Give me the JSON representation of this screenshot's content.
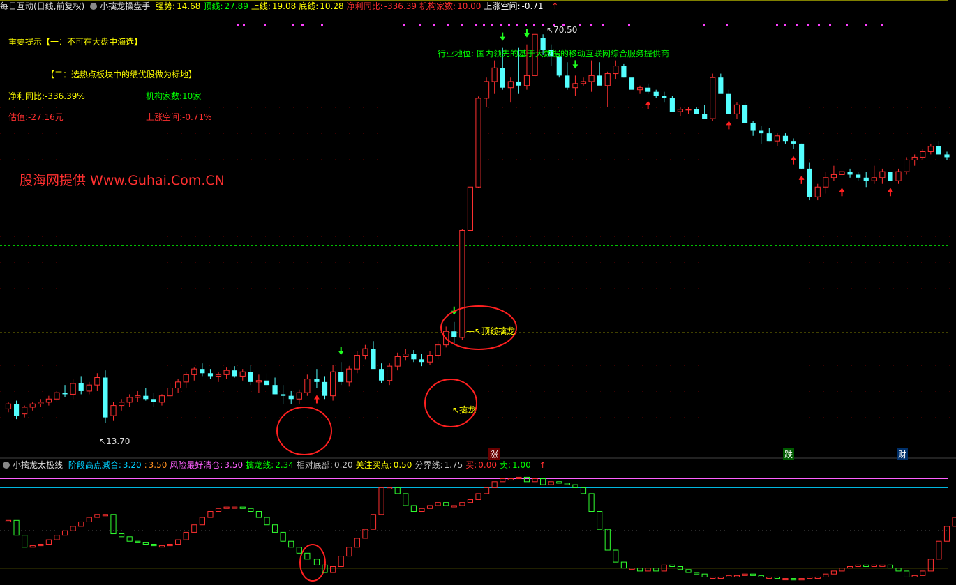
{
  "header": {
    "stock": "每日互动(日线,前复权)",
    "indicator": "小擒龙操盘手",
    "items": [
      {
        "label": "强势:",
        "value": "14.68",
        "lc": "#ffff00",
        "vc": "#ffff00"
      },
      {
        "label": "顶线:",
        "value": "27.89",
        "lc": "#00ff00",
        "vc": "#00ff00"
      },
      {
        "label": "上线:",
        "value": "19.08",
        "lc": "#ffff00",
        "vc": "#ffff00"
      },
      {
        "label": "底线:",
        "value": "10.28",
        "lc": "#ffff00",
        "vc": "#ffff00"
      },
      {
        "label": "净利同比:",
        "value": "-336.39",
        "lc": "#ff3030",
        "vc": "#ff3030"
      },
      {
        "label": "机构家数:",
        "value": "10.00",
        "lc": "#ff3030",
        "vc": "#ff3030"
      },
      {
        "label": "上涨空间:",
        "value": "-0.71",
        "lc": "#ffffff",
        "vc": "#ffffff"
      }
    ]
  },
  "notes": {
    "tip1": "重要提示【一：不可在大盘中海选】",
    "tip2": "【二：选热点板块中的绩优股做为标地】",
    "profit": "净利同比:-336.39%",
    "inst": "机构家数:10家",
    "val": "估值:-27.16元",
    "space": "上涨空间:-0.71%",
    "industry": "行业地位: 国内领先的基于大数据的移动互联网综合服务提供商",
    "watermark": "股海网提供 Www.Guhai.Com.CN",
    "high_label": "70.50",
    "low_label": "13.70",
    "top_dragon": "顶线擒龙",
    "dragon": "擒龙",
    "m_zhang": "涨",
    "m_die": "跌",
    "m_cai": "财"
  },
  "indicator": {
    "title": "小擒龙太极线",
    "items": [
      {
        "label": "阶段高点减合:",
        "value": "3.20",
        "c": "#00d0ff"
      },
      {
        "label": ":",
        "value": "3.50",
        "c": "#ff9020"
      },
      {
        "label": "风险最好清仓:",
        "value": "3.50",
        "c": "#ff60ff"
      },
      {
        "label": "擒龙线:",
        "value": "2.34",
        "c": "#00ff00"
      },
      {
        "label": "相对底部:",
        "value": "0.20",
        "c": "#c0c0c0"
      },
      {
        "label": "关注买点:",
        "value": "0.50",
        "c": "#ffff00"
      },
      {
        "label": "分界线:",
        "value": "1.75",
        "c": "#c0c0c0"
      },
      {
        "label": "买:",
        "value": "0.00",
        "c": "#ff3030"
      },
      {
        "label": "卖:",
        "value": "1.00",
        "c": "#00ff00"
      }
    ]
  },
  "colors": {
    "up": "#ff3030",
    "down": "#54ffff",
    "bg": "#000000",
    "topline": "#00ff00",
    "midline": "#ffff00",
    "bottomline": "#ffff00"
  },
  "chart_data": {
    "type": "candlestick",
    "price": [
      [
        13.7,
        14.1,
        13.5,
        14.0
      ],
      [
        14.0,
        14.2,
        13.1,
        13.3
      ],
      [
        13.4,
        13.9,
        13.2,
        13.8
      ],
      [
        13.8,
        14.1,
        13.6,
        14.0
      ],
      [
        14.0,
        14.3,
        13.8,
        14.1
      ],
      [
        14.1,
        14.5,
        13.9,
        14.3
      ],
      [
        14.3,
        14.8,
        14.1,
        14.7
      ],
      [
        14.7,
        15.2,
        14.4,
        14.6
      ],
      [
        14.6,
        15.6,
        14.3,
        15.3
      ],
      [
        15.3,
        15.8,
        14.6,
        14.8
      ],
      [
        14.8,
        15.4,
        14.6,
        15.2
      ],
      [
        15.2,
        16.0,
        14.8,
        15.7
      ],
      [
        15.7,
        16.2,
        12.9,
        13.2
      ],
      [
        13.3,
        14.1,
        13.0,
        13.9
      ],
      [
        13.9,
        14.3,
        13.6,
        14.1
      ],
      [
        14.1,
        14.6,
        13.8,
        14.4
      ],
      [
        14.4,
        14.8,
        14.1,
        14.5
      ],
      [
        14.5,
        15.0,
        14.2,
        14.3
      ],
      [
        14.3,
        14.7,
        13.8,
        14.1
      ],
      [
        14.1,
        14.6,
        13.9,
        14.5
      ],
      [
        14.5,
        15.3,
        14.3,
        15.0
      ],
      [
        15.0,
        15.6,
        14.7,
        15.4
      ],
      [
        15.4,
        16.1,
        15.0,
        15.9
      ],
      [
        15.9,
        16.4,
        15.5,
        16.3
      ],
      [
        16.3,
        16.7,
        15.8,
        16.0
      ],
      [
        16.0,
        16.3,
        15.6,
        15.8
      ],
      [
        15.8,
        16.1,
        15.4,
        15.9
      ],
      [
        15.9,
        16.4,
        15.6,
        16.2
      ],
      [
        16.2,
        16.5,
        15.7,
        15.8
      ],
      [
        15.8,
        16.3,
        15.5,
        16.1
      ],
      [
        16.1,
        16.6,
        15.2,
        15.4
      ],
      [
        15.4,
        15.9,
        14.7,
        15.5
      ],
      [
        15.5,
        16.0,
        15.0,
        15.2
      ],
      [
        15.2,
        15.7,
        14.6,
        14.6
      ],
      [
        14.6,
        15.2,
        14.0,
        14.5
      ],
      [
        14.5,
        14.8,
        14.0,
        14.3
      ],
      [
        14.3,
        14.9,
        14.0,
        14.7
      ],
      [
        14.7,
        15.9,
        14.5,
        15.6
      ],
      [
        15.6,
        16.3,
        15.0,
        15.4
      ],
      [
        15.4,
        15.8,
        14.3,
        14.5
      ],
      [
        14.5,
        16.6,
        14.2,
        16.1
      ],
      [
        16.1,
        16.8,
        15.2,
        15.4
      ],
      [
        15.4,
        16.5,
        15.1,
        16.3
      ],
      [
        16.3,
        17.6,
        16.0,
        17.3
      ],
      [
        17.3,
        18.1,
        17.0,
        17.8
      ],
      [
        17.8,
        18.4,
        16.9,
        16.3
      ],
      [
        16.3,
        16.7,
        15.3,
        15.5
      ],
      [
        15.5,
        16.7,
        15.2,
        16.5
      ],
      [
        16.5,
        17.5,
        16.2,
        17.2
      ],
      [
        17.2,
        17.8,
        16.9,
        17.4
      ],
      [
        17.4,
        17.7,
        16.8,
        17.0
      ],
      [
        17.0,
        17.4,
        16.5,
        16.8
      ],
      [
        16.8,
        17.6,
        16.6,
        17.3
      ],
      [
        17.3,
        18.4,
        17.0,
        18.1
      ],
      [
        18.1,
        19.6,
        17.9,
        19.2
      ],
      [
        19.2,
        20.0,
        18.2,
        18.7
      ],
      [
        18.7,
        30.0,
        18.5,
        29.8
      ],
      [
        29.8,
        36.0,
        29.7,
        36.0
      ],
      [
        36.0,
        53.4,
        35.9,
        53.0
      ],
      [
        53.0,
        58.0,
        51.0,
        57.0
      ],
      [
        57.0,
        62.5,
        54.0,
        60.5
      ],
      [
        60.5,
        66.0,
        55.0,
        55.5
      ],
      [
        55.5,
        58.0,
        52.0,
        57.0
      ],
      [
        57.0,
        66.0,
        54.0,
        56.0
      ],
      [
        56.0,
        67.0,
        55.0,
        58.5
      ],
      [
        58.5,
        70.5,
        58.0,
        70.0
      ],
      [
        69.0,
        70.0,
        64.0,
        65.5
      ],
      [
        65.5,
        67.0,
        61.0,
        63.5
      ],
      [
        63.5,
        64.0,
        58.0,
        58.5
      ],
      [
        58.5,
        62.0,
        55.0,
        55.5
      ],
      [
        55.5,
        58.5,
        53.5,
        56.5
      ],
      [
        56.5,
        58.0,
        56.0,
        57.0
      ],
      [
        57.0,
        62.5,
        54.5,
        58.5
      ],
      [
        58.5,
        62.0,
        57.0,
        56.0
      ],
      [
        56.0,
        59.5,
        51.0,
        59.0
      ],
      [
        59.0,
        62.5,
        57.5,
        61.0
      ],
      [
        61.0,
        61.5,
        58.0,
        58.0
      ],
      [
        58.0,
        57.5,
        55.5,
        55.0
      ],
      [
        55.0,
        56.0,
        54.0,
        55.5
      ],
      [
        55.5,
        56.5,
        54.0,
        54.5
      ],
      [
        54.5,
        55.0,
        53.0,
        53.5
      ],
      [
        53.5,
        54.5,
        52.0,
        53.0
      ],
      [
        53.0,
        53.5,
        50.5,
        50.0
      ],
      [
        50.0,
        51.0,
        49.0,
        50.5
      ],
      [
        50.5,
        51.0,
        49.5,
        50.5
      ],
      [
        50.5,
        51.0,
        49.5,
        49.5
      ],
      [
        49.5,
        51.5,
        48.5,
        48.5
      ],
      [
        48.5,
        59.0,
        48.0,
        58.0
      ],
      [
        58.0,
        59.0,
        54.5,
        54.0
      ],
      [
        54.0,
        55.0,
        49.5,
        49.5
      ],
      [
        49.5,
        52.0,
        48.5,
        51.5
      ],
      [
        51.5,
        52.0,
        48.0,
        47.5
      ],
      [
        47.5,
        48.0,
        45.0,
        46.0
      ],
      [
        46.0,
        47.0,
        43.5,
        45.5
      ],
      [
        45.5,
        46.5,
        44.0,
        44.0
      ],
      [
        44.0,
        45.5,
        43.0,
        45.0
      ],
      [
        45.0,
        45.5,
        43.5,
        44.0
      ],
      [
        44.0,
        44.5,
        42.5,
        43.5
      ],
      [
        43.5,
        43.5,
        39.0,
        39.0
      ],
      [
        39.0,
        40.0,
        34.0,
        34.5
      ],
      [
        34.5,
        36.5,
        34.0,
        36.0
      ],
      [
        36.0,
        38.5,
        35.0,
        37.5
      ],
      [
        37.5,
        39.5,
        37.0,
        38.0
      ],
      [
        38.0,
        39.0,
        37.0,
        38.5
      ],
      [
        38.5,
        39.0,
        37.5,
        38.0
      ],
      [
        38.0,
        38.5,
        37.0,
        37.5
      ],
      [
        37.5,
        38.5,
        36.0,
        37.0
      ],
      [
        37.0,
        39.5,
        36.5,
        37.5
      ],
      [
        37.5,
        39.0,
        36.5,
        38.5
      ],
      [
        38.5,
        38.5,
        37.0,
        37.0
      ],
      [
        37.0,
        39.0,
        36.5,
        38.5
      ],
      [
        38.5,
        41.0,
        38.0,
        40.5
      ],
      [
        40.5,
        41.5,
        39.5,
        41.0
      ],
      [
        41.0,
        42.5,
        40.5,
        42.0
      ],
      [
        42.0,
        43.5,
        41.5,
        43.0
      ],
      [
        43.0,
        44.0,
        42.0,
        41.5
      ],
      [
        41.5,
        42.0,
        40.5,
        41.0
      ]
    ],
    "gap_after_index": 37,
    "ylim": [
      12.0,
      72.0
    ],
    "levels": {
      "top": 27.89,
      "up": 19.08,
      "bottom": 10.28
    },
    "high": 70.5,
    "low": 13.7,
    "indicator_line_levels": {
      "risk": 3.5,
      "stage_high": 3.2,
      "divider": 1.75,
      "focus_buy": 0.5,
      "relative_bottom": 0.2
    },
    "indicator_values": [
      2.1,
      1.6,
      1.2,
      1.25,
      1.3,
      1.45,
      1.6,
      1.75,
      1.9,
      2.05,
      2.2,
      2.3,
      2.3,
      1.65,
      1.55,
      1.4,
      1.35,
      1.3,
      1.25,
      1.25,
      1.3,
      1.45,
      1.7,
      1.95,
      2.2,
      2.4,
      2.5,
      2.55,
      2.55,
      2.5,
      2.4,
      2.2,
      1.95,
      1.7,
      1.4,
      1.2,
      1.0,
      0.8,
      0.6,
      0.35,
      0.55,
      0.9,
      1.2,
      1.5,
      1.8,
      2.3,
      3.2,
      3.2,
      3.0,
      2.6,
      2.4,
      2.5,
      2.6,
      2.7,
      2.6,
      2.6,
      2.7,
      2.8,
      3.0,
      3.2,
      3.4,
      3.5,
      3.5,
      3.55,
      3.4,
      3.5,
      3.3,
      3.4,
      3.35,
      3.3,
      3.2,
      3.0,
      2.4,
      1.8,
      1.1,
      0.7,
      0.5,
      0.5,
      0.4,
      0.5,
      0.4,
      0.6,
      0.55,
      0.45,
      0.35,
      0.3,
      0.2,
      0.2,
      0.2,
      0.25,
      0.25,
      0.3,
      0.25,
      0.2,
      0.2,
      0.15,
      0.15,
      0.1,
      0.15,
      0.2,
      0.2,
      0.3,
      0.4,
      0.5,
      0.55,
      0.6,
      0.55,
      0.6,
      0.6,
      0.5,
      0.4,
      0.2,
      0.25,
      0.4,
      0.8,
      1.4,
      1.9,
      2.2,
      2.3
    ],
    "buy_signals": [
      38,
      79,
      89,
      97,
      98,
      103,
      109
    ],
    "sell_signals": [
      41,
      55,
      61,
      64,
      70
    ]
  }
}
